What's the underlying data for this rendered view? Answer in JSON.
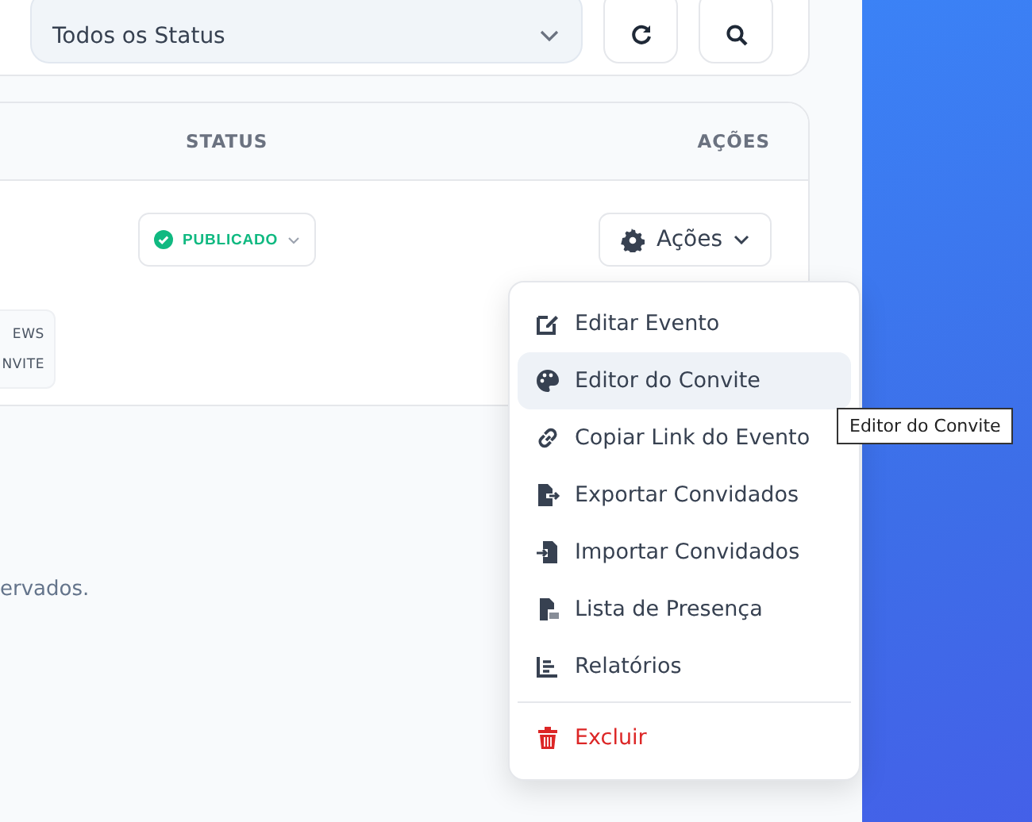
{
  "filters": {
    "status_select": "Todos os Status"
  },
  "table": {
    "columns": [
      "STATUS",
      "AÇÕES"
    ],
    "rows": [
      {
        "status": "PUBLICADO",
        "tags": [
          "EWS",
          "NVITE"
        ],
        "actions_button": "Ações"
      }
    ]
  },
  "actions_menu": {
    "items": [
      {
        "label": "Editar Evento",
        "kind": "edit",
        "highlighted": false
      },
      {
        "label": "Editor do Convite",
        "kind": "palette",
        "highlighted": true
      },
      {
        "label": "Copiar Link do Evento",
        "kind": "link",
        "highlighted": false
      },
      {
        "label": "Exportar Convidados",
        "kind": "export",
        "highlighted": false
      },
      {
        "label": "Importar Convidados",
        "kind": "import",
        "highlighted": false
      },
      {
        "label": "Lista de Presença",
        "kind": "pdf",
        "highlighted": false
      },
      {
        "label": "Relatórios",
        "kind": "chart",
        "highlighted": false
      },
      {
        "label": "Excluir",
        "kind": "delete",
        "highlighted": false
      }
    ]
  },
  "tooltip": "Editor do Convite",
  "footer": "ervados."
}
